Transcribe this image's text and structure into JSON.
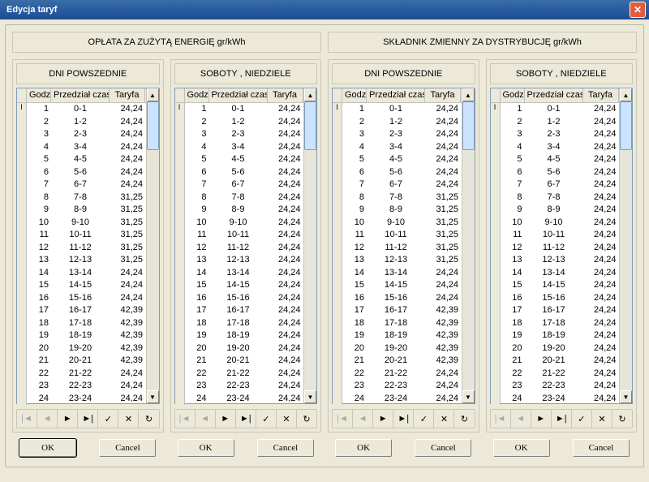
{
  "window": {
    "title": "Edycja taryf"
  },
  "section_headers": {
    "left": "OPŁATA ZA ZUŻYTĄ ENERGIĘ gr/kWh",
    "right": "SKŁADNIK ZMIENNY ZA DYSTRYBUCJĘ gr/kWh"
  },
  "subheaders": {
    "weekday": "DNI POWSZEDNIE",
    "weekend": "SOBOTY , NIEDZIELE"
  },
  "columns": {
    "godz": "Godz",
    "przedzial": "Przedział czasu",
    "taryfa": "Taryfa"
  },
  "buttons": {
    "ok": "OK",
    "cancel": "Cancel"
  },
  "nav_icons": [
    "|◄",
    "◄",
    "►",
    "►|",
    "✓",
    "✕",
    "↻"
  ],
  "row_marker": "I",
  "hours": [
    "1",
    "2",
    "3",
    "4",
    "5",
    "6",
    "7",
    "8",
    "9",
    "10",
    "11",
    "12",
    "13",
    "14",
    "15",
    "16",
    "17",
    "18",
    "19",
    "20",
    "21",
    "22",
    "23",
    "24"
  ],
  "ranges": [
    "0-1",
    "1-2",
    "2-3",
    "3-4",
    "4-5",
    "5-6",
    "6-7",
    "7-8",
    "8-9",
    "9-10",
    "10-11",
    "11-12",
    "12-13",
    "13-14",
    "14-15",
    "15-16",
    "16-17",
    "17-18",
    "18-19",
    "19-20",
    "20-21",
    "21-22",
    "22-23",
    "23-24"
  ],
  "tariffs": {
    "energy_weekday": [
      "24,24",
      "24,24",
      "24,24",
      "24,24",
      "24,24",
      "24,24",
      "24,24",
      "31,25",
      "31,25",
      "31,25",
      "31,25",
      "31,25",
      "31,25",
      "24,24",
      "24,24",
      "24,24",
      "42,39",
      "42,39",
      "42,39",
      "42,39",
      "42,39",
      "24,24",
      "24,24",
      "24,24"
    ],
    "energy_weekend": [
      "24,24",
      "24,24",
      "24,24",
      "24,24",
      "24,24",
      "24,24",
      "24,24",
      "24,24",
      "24,24",
      "24,24",
      "24,24",
      "24,24",
      "24,24",
      "24,24",
      "24,24",
      "24,24",
      "24,24",
      "24,24",
      "24,24",
      "24,24",
      "24,24",
      "24,24",
      "24,24",
      "24,24"
    ],
    "dist_weekday": [
      "24,24",
      "24,24",
      "24,24",
      "24,24",
      "24,24",
      "24,24",
      "24,24",
      "31,25",
      "31,25",
      "31,25",
      "31,25",
      "31,25",
      "31,25",
      "24,24",
      "24,24",
      "24,24",
      "42,39",
      "42,39",
      "42,39",
      "42,39",
      "42,39",
      "24,24",
      "24,24",
      "24,24"
    ],
    "dist_weekend": [
      "24,24",
      "24,24",
      "24,24",
      "24,24",
      "24,24",
      "24,24",
      "24,24",
      "24,24",
      "24,24",
      "24,24",
      "24,24",
      "24,24",
      "24,24",
      "24,24",
      "24,24",
      "24,24",
      "24,24",
      "24,24",
      "24,24",
      "24,24",
      "24,24",
      "24,24",
      "24,24",
      "24,24"
    ]
  }
}
